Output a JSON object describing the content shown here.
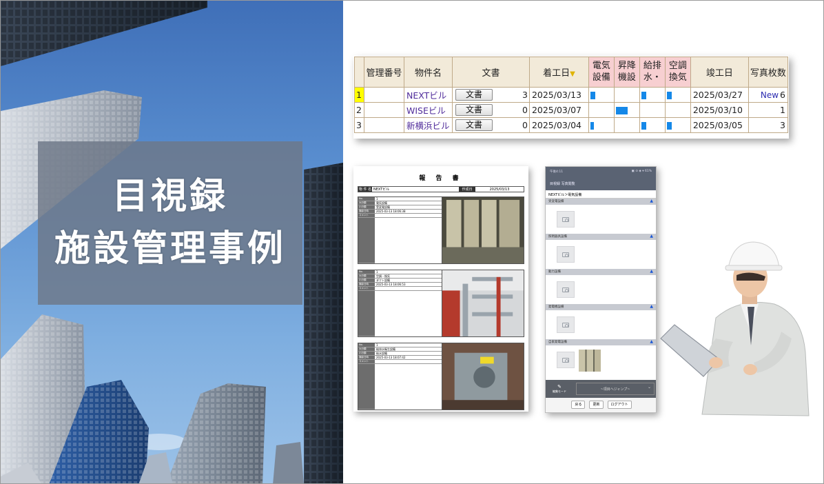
{
  "slide": {
    "title_lines": [
      "目視録",
      "施設管理事例"
    ]
  },
  "table": {
    "headers": {
      "rowno": "",
      "mgmt": "管理番号",
      "name": "物件名",
      "doc": "文書",
      "start": "着工日",
      "elec": [
        "電気",
        "設備"
      ],
      "lift": [
        "昇降",
        "機設"
      ],
      "water": [
        "給排",
        "水・"
      ],
      "air": [
        "空調",
        "換気"
      ],
      "end": "竣工日",
      "photos": "写真枚数"
    },
    "sort_indicator": "▼",
    "doc_button_label": "文書",
    "new_label": "New",
    "rows": [
      {
        "no": "1",
        "mgmt": "",
        "name": "NEXTビル",
        "doc_count": "3",
        "start": "2025/03/13",
        "end": "2025/03/27",
        "photos": "6",
        "is_new": true,
        "highlight": true,
        "progress": {
          "elec": 0.2,
          "lift": 0,
          "water": 0.2,
          "air": 0.2
        }
      },
      {
        "no": "2",
        "mgmt": "",
        "name": "WISEビル",
        "doc_count": "0",
        "start": "2025/03/07",
        "end": "2025/03/10",
        "photos": "1",
        "is_new": false,
        "highlight": false,
        "progress": {
          "elec": 0,
          "lift": 0.5,
          "water": 0,
          "air": 0
        }
      },
      {
        "no": "3",
        "mgmt": "",
        "name": "新横浜ビル",
        "doc_count": "0",
        "start": "2025/03/04",
        "end": "2025/03/05",
        "photos": "3",
        "is_new": false,
        "highlight": false,
        "progress": {
          "elec": 0.1,
          "lift": 0,
          "water": 0.2,
          "air": 0.2
        }
      }
    ]
  },
  "report": {
    "title": "報 告 書",
    "head_label": "物 件 名",
    "head_value": "NEXTビル",
    "date_label": "作成日",
    "date_value": "2025/03/13",
    "field_labels": [
      "No.",
      "大分類",
      "小分類",
      "撮影日時",
      "コメント"
    ],
    "entries": [
      {
        "values": [
          "1",
          "電気設備",
          "受変電設備",
          "2025-03-13 18:06:38",
          ""
        ]
      },
      {
        "values": [
          "1",
          "空調・換気",
          "ダクト設備",
          "2025-03-13 18:06:53",
          ""
        ]
      },
      {
        "values": [
          "1",
          "給排水衛生設備",
          "給水設備",
          "2025-03-13 18:07:42",
          ""
        ]
      }
    ]
  },
  "phone": {
    "status_left": "午後4:11",
    "status_right": "▣ ⊙ ◈ ▾ 61%",
    "appbar_title": "目視録 写真閲覧",
    "path": "NEXTビル＞電気設備",
    "sections": [
      "受変電設備",
      "照明器具設備",
      "動力設備",
      "発電機設備",
      "自家発電設備"
    ],
    "collapse_icon": "▲",
    "edit_mode_label": "編集モード",
    "jump_label": "~項目へジャンプ~",
    "buttons": [
      "戻る",
      "更新",
      "ログアウト"
    ]
  },
  "colors": {
    "header_bg": "#f2ead9",
    "pink_header": "#f7cfd1",
    "progress_bar": "#1588e8",
    "highlight": "#ffff00",
    "name_link": "#4f2b9a"
  }
}
